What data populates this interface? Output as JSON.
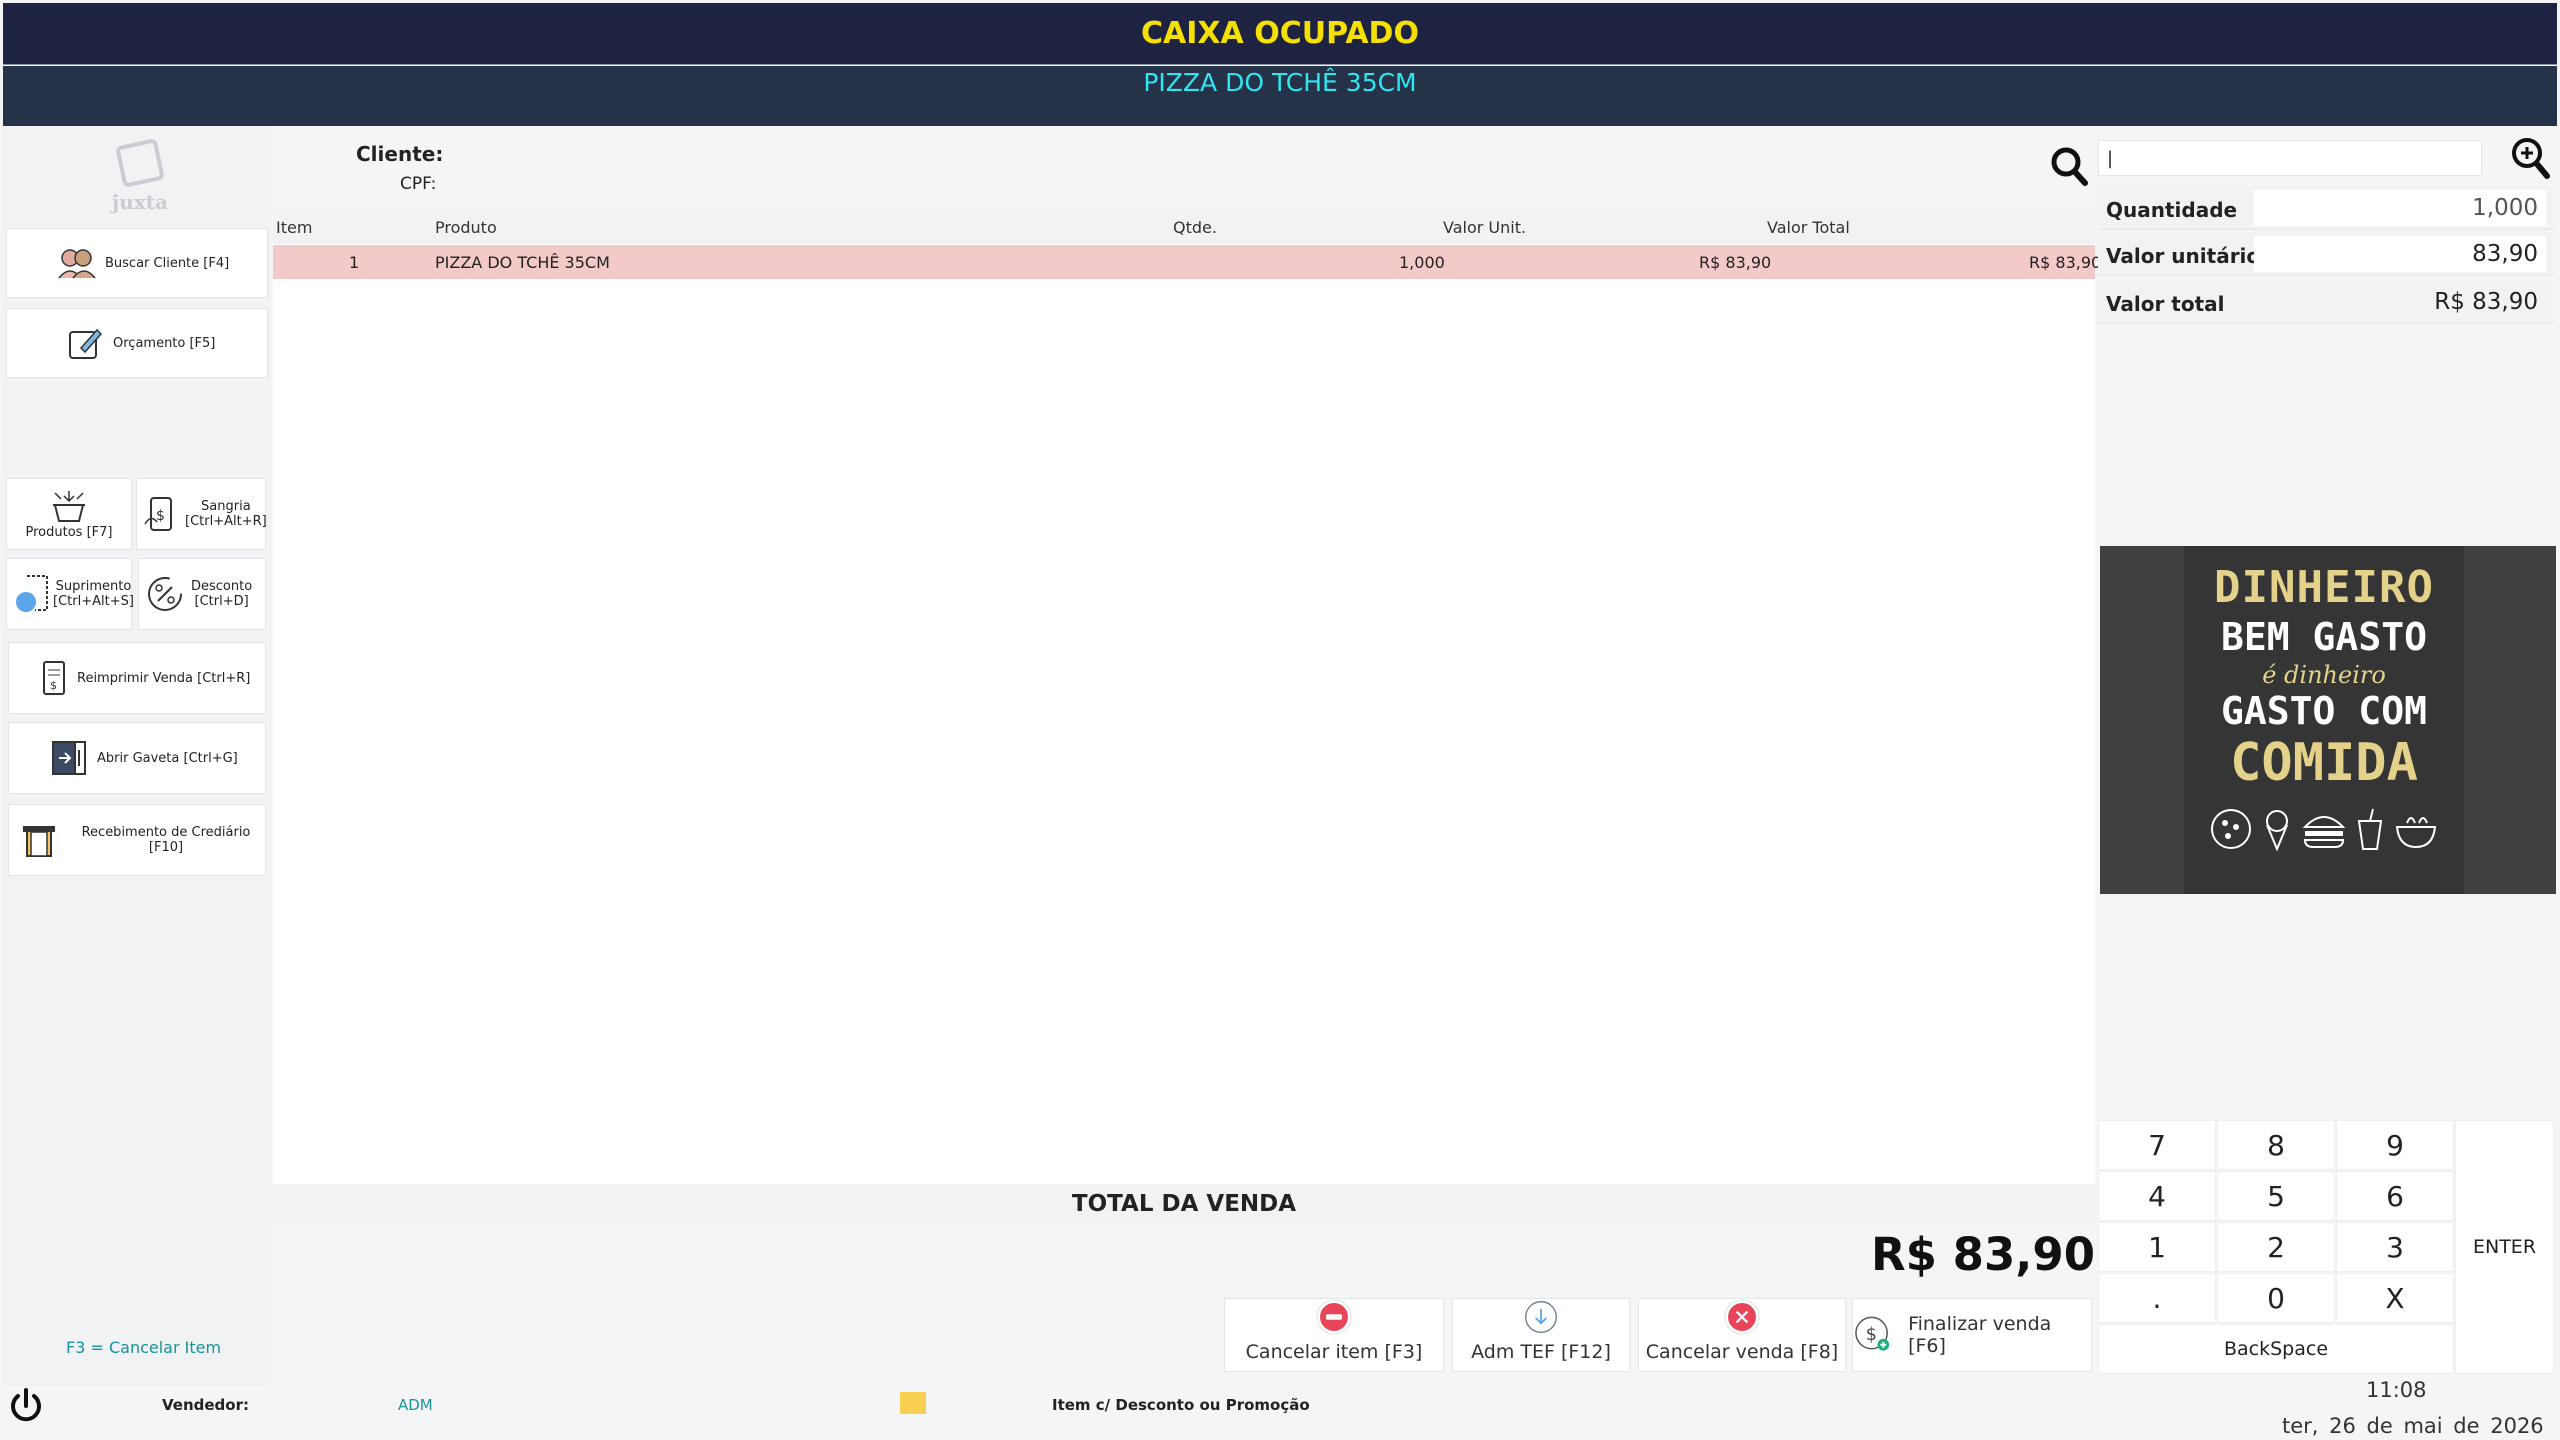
{
  "header": {
    "status": "CAIXA OCUPADO",
    "product": "PIZZA DO TCHÊ 35CM"
  },
  "logo": {
    "text": "juxta"
  },
  "left_menu": {
    "buscar_cliente": "Buscar Cliente [F4]",
    "orcamento": "Orçamento [F5]",
    "produtos": "Produtos [F7]",
    "sangria": "Sangria\n[Ctrl+Alt+R]",
    "suprimento": "Suprimento\n[Ctrl+Alt+S]",
    "desconto": "Desconto\n[Ctrl+D]",
    "reimprimir": "Reimprimir Venda [Ctrl+R]",
    "abrir_gaveta": "Abrir Gaveta [Ctrl+G]",
    "recebimento": "Recebimento de Crediário [F10]"
  },
  "customer": {
    "label": "Cliente:",
    "cpf_label": "CPF:"
  },
  "table": {
    "headers": {
      "item": "Item",
      "produto": "Produto",
      "qtde": "Qtde.",
      "valor_unit": "Valor Unit.",
      "valor_total": "Valor Total"
    },
    "rows": [
      {
        "item": "1",
        "produto": "PIZZA DO TCHÊ 35CM",
        "qtde": "1,000",
        "valor_unit": "R$ 83,90",
        "valor_total": "R$ 83,90"
      }
    ]
  },
  "totals": {
    "label": "TOTAL DA VENDA",
    "value": "R$ 83,90"
  },
  "actions": {
    "cancelar_item": "Cancelar item [F3]",
    "adm_tef": "Adm TEF [F12]",
    "cancelar_venda": "Cancelar venda [F8]",
    "finalizar_venda": "Finalizar venda [F6]"
  },
  "right_panel": {
    "search_value": "|",
    "quantidade_label": "Quantidade",
    "quantidade_value": "1,000",
    "valor_unitario_label": "Valor unitário",
    "valor_unitario_value": "83,90",
    "valor_total_label": "Valor total",
    "valor_total_value": "R$ 83,90"
  },
  "promo": {
    "line1": "DINHEIRO",
    "line2": "BEM GASTO",
    "line3": "é dinheiro",
    "line4": "GASTO COM",
    "line5": "COMIDA"
  },
  "keypad": {
    "k7": "7",
    "k8": "8",
    "k9": "9",
    "k4": "4",
    "k5": "5",
    "k6": "6",
    "k1": "1",
    "k2": "2",
    "k3": "3",
    "kdot": ".",
    "k0": "0",
    "kx": "X",
    "enter": "ENTER",
    "backspace": "BackSpace"
  },
  "footer": {
    "hint": "F3 = Cancelar Item",
    "vendedor_label": "Vendedor:",
    "vendedor_value": "ADM",
    "legend_label": "Item c/ Desconto ou Promoção",
    "time": "11:08",
    "date": "ter, 26 de mai de 2026"
  },
  "colors": {
    "header_bg": "#1d2340",
    "status_text": "#f5e000",
    "product_text": "#2ee6f0",
    "row_highlight": "#f4c9c9",
    "promo_legend": "#f8cf50",
    "danger": "#e8455a"
  }
}
